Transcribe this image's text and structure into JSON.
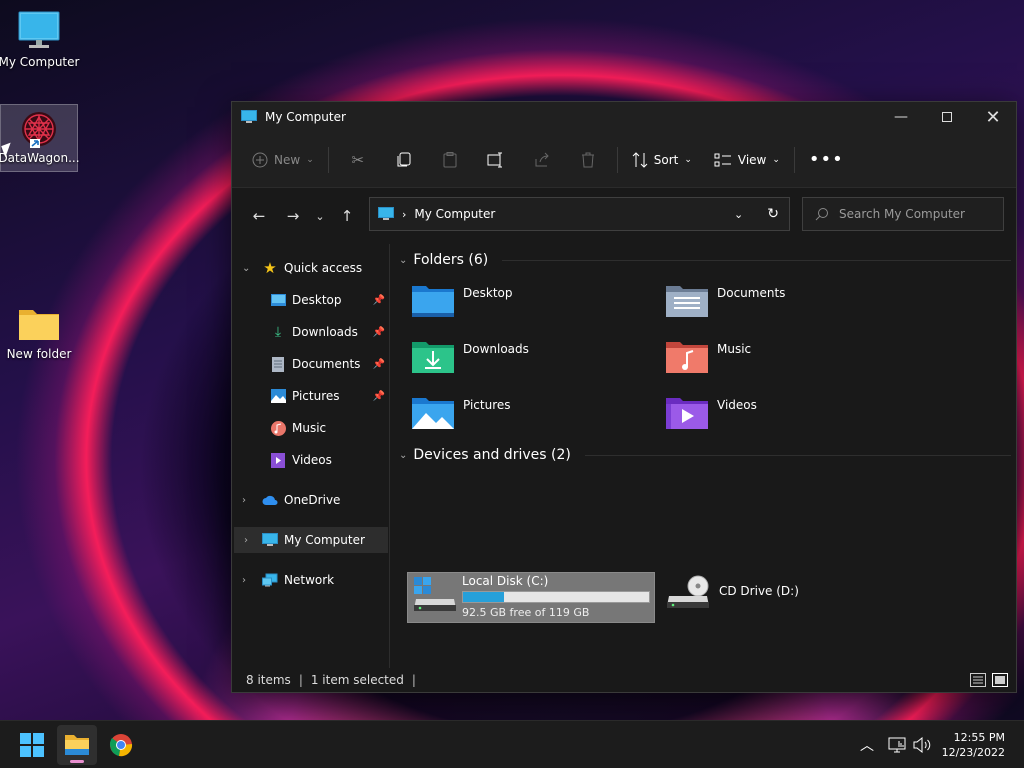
{
  "desktop": {
    "icons": [
      {
        "label": "My Computer"
      },
      {
        "label": "DataWagon..."
      },
      {
        "label": "New folder"
      }
    ]
  },
  "window": {
    "title": "My Computer",
    "toolbar": {
      "new_label": "New",
      "sort_label": "Sort",
      "view_label": "View"
    },
    "address": {
      "path": "My Computer"
    },
    "search": {
      "placeholder": "Search My Computer"
    },
    "sidebar": {
      "quick_access": "Quick access",
      "items": [
        {
          "label": "Desktop",
          "icon": "desktop-icon"
        },
        {
          "label": "Downloads",
          "icon": "downloads-icon"
        },
        {
          "label": "Documents",
          "icon": "documents-icon"
        },
        {
          "label": "Pictures",
          "icon": "pictures-icon"
        },
        {
          "label": "Music",
          "icon": "music-icon"
        },
        {
          "label": "Videos",
          "icon": "videos-icon"
        }
      ],
      "onedrive": "OneDrive",
      "my_computer": "My Computer",
      "network": "Network"
    },
    "folders_header": "Folders (6)",
    "folders": [
      {
        "label": "Desktop"
      },
      {
        "label": "Documents"
      },
      {
        "label": "Downloads"
      },
      {
        "label": "Music"
      },
      {
        "label": "Pictures"
      },
      {
        "label": "Videos"
      }
    ],
    "drives_header": "Devices and drives (2)",
    "drives": [
      {
        "label": "Local Disk (C:)",
        "free": "92.5 GB free of 119 GB",
        "used_fraction": 0.22
      },
      {
        "label": "CD Drive (D:)"
      }
    ],
    "status": {
      "items": "8 items",
      "selected": "1 item selected"
    }
  },
  "taskbar": {
    "time": "12:55 PM",
    "date": "12/23/2022"
  },
  "colors": {
    "accent": "#26a0da",
    "folder": "#f7c948",
    "drive_bar": "#26a0da"
  }
}
